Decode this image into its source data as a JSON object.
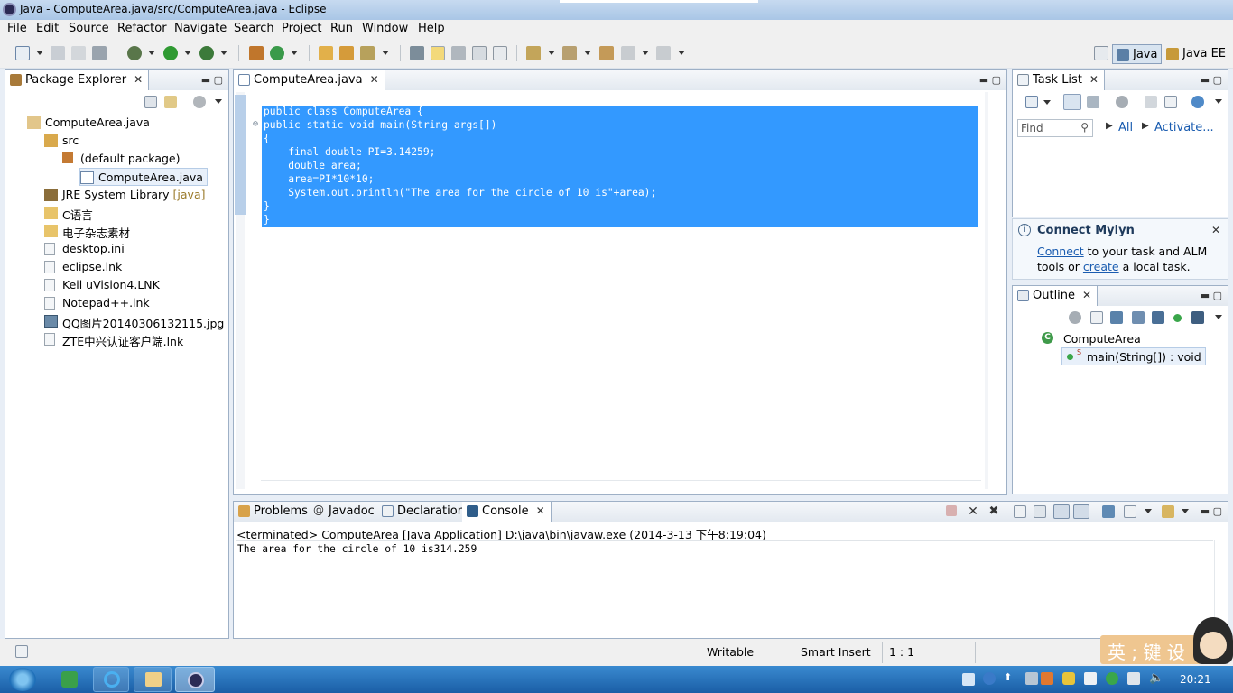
{
  "window": {
    "title": "Java - ComputeArea.java/src/ComputeArea.java - Eclipse"
  },
  "menu": [
    "File",
    "Edit",
    "Source",
    "Refactor",
    "Navigate",
    "Search",
    "Project",
    "Run",
    "Window",
    "Help"
  ],
  "perspectives": {
    "java": "Java",
    "java_ee": "Java EE"
  },
  "package_explorer": {
    "tab": "Package Explorer",
    "items": [
      {
        "label": "ComputeArea.java",
        "icon": "project-icon"
      },
      {
        "label": "src",
        "icon": "source-folder-icon"
      },
      {
        "label": "(default package)",
        "icon": "package-icon"
      },
      {
        "label": "ComputeArea.java",
        "icon": "java-file-icon"
      },
      {
        "label": "JRE System Library",
        "suffix": "[java]",
        "icon": "library-icon"
      },
      {
        "label": "C语言",
        "icon": "folder-icon"
      },
      {
        "label": "电子杂志素材",
        "icon": "folder-icon"
      },
      {
        "label": "desktop.ini",
        "icon": "file-icon"
      },
      {
        "label": "eclipse.lnk",
        "icon": "file-icon"
      },
      {
        "label": "Keil uVision4.LNK",
        "icon": "file-icon"
      },
      {
        "label": "Notepad++.lnk",
        "icon": "file-icon"
      },
      {
        "label": "QQ图片20140306132115.jpg",
        "icon": "image-file-icon"
      },
      {
        "label": "ZTE中兴认证客户端.lnk",
        "icon": "file-icon"
      }
    ]
  },
  "editor": {
    "tab": "ComputeArea.java",
    "lines": [
      "public class ComputeArea {",
      "public static void main(String args[])",
      "{",
      "    final double PI=3.14259;",
      "    double area;",
      "    area=PI*10*10;",
      "    System.out.println(\"The area for the circle of 10 is\"+area);",
      "}",
      "}"
    ]
  },
  "task_list": {
    "tab": "Task List",
    "find_placeholder": "Find",
    "all_label": "All",
    "activate_label": "Activate..."
  },
  "mylyn": {
    "title": "Connect Mylyn",
    "connect_link": "Connect",
    "text1": " to your task and ALM",
    "text2": "tools or ",
    "create_link": "create",
    "text3": " a local task."
  },
  "outline": {
    "tab": "Outline",
    "class_name": "ComputeArea",
    "method_name": "main(String[]) : void"
  },
  "bottom_tabs": {
    "problems": "Problems",
    "javadoc": "Javadoc",
    "declaration": "Declaration",
    "console": "Console"
  },
  "console": {
    "header": "<terminated> ComputeArea [Java Application] D:\\java\\bin\\javaw.exe (2014-3-13 下午8:19:04)",
    "output": "The area for the circle of 10 is314.259"
  },
  "status": {
    "writable": "Writable",
    "insert_mode": "Smart Insert",
    "position": "1 : 1"
  },
  "ime": {
    "label": "英 ; 键 设"
  },
  "taskbar": {
    "time": "20:21"
  },
  "colors": {
    "selection": "#3399ff",
    "taskbar": "#1f65ae",
    "link": "#1a5cb0",
    "library_suffix": "#9a7a2a"
  }
}
